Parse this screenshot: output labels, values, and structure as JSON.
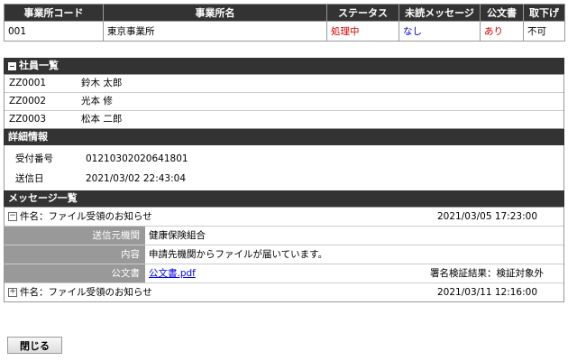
{
  "office_table": {
    "headers": [
      "事業所コード",
      "事業所名",
      "ステータス",
      "未読メッセージ",
      "公文書",
      "取下げ"
    ],
    "row": {
      "code": "001",
      "name": "東京事業所",
      "status": "処理中",
      "unread": "なし",
      "official_doc": "あり",
      "withdraw": "不可"
    },
    "colors": {
      "status": "#d40000",
      "unread": "#0000cc",
      "official_doc": "#d40000"
    }
  },
  "employees": {
    "title": "社員一覧",
    "items": [
      {
        "code": "ZZ0001",
        "name": "鈴木 太郎"
      },
      {
        "code": "ZZ0002",
        "name": "光本 修"
      },
      {
        "code": "ZZ0003",
        "name": "松本 二郎"
      }
    ]
  },
  "details": {
    "title": "詳細情報",
    "receipt_label": "受付番号",
    "receipt_value": "01210302020641801",
    "sent_label": "送信日",
    "sent_value": "2021/03/02 22:43:04"
  },
  "messages": {
    "title": "メッセージ一覧",
    "items": [
      {
        "toggle": "−",
        "subject": "件名：ファイル受領のお知らせ",
        "date": "2021/03/05 17:23:00",
        "sender_label": "送信元機関",
        "sender_value": "健康保険組合",
        "content_label": "内容",
        "content_value": "申請先機関からファイルが届いています。",
        "doc_label": "公文書",
        "doc_link": "公文書.pdf",
        "signature": "署名検証結果：検証対象外"
      },
      {
        "toggle": "+",
        "subject": "件名：ファイル受領のお知らせ",
        "date": "2021/03/11 12:16:00"
      }
    ]
  },
  "close_button": {
    "label": "閉じる"
  }
}
